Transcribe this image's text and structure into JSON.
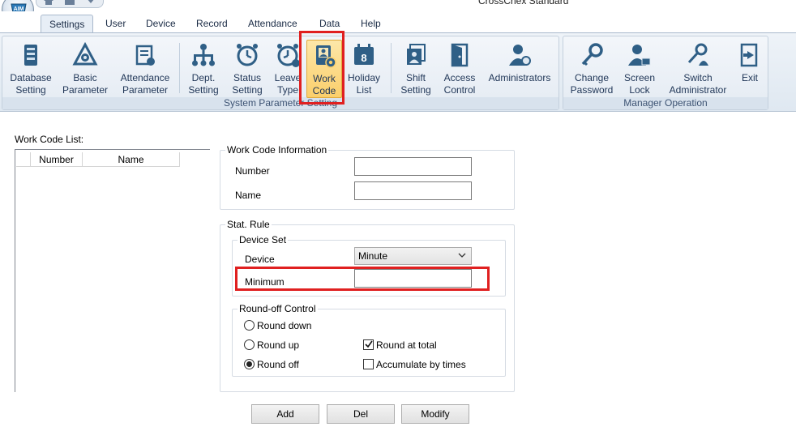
{
  "window": {
    "title": "CrossChex Standard"
  },
  "tabs": [
    {
      "label": "Settings",
      "active": true
    },
    {
      "label": "User"
    },
    {
      "label": "Device"
    },
    {
      "label": "Record"
    },
    {
      "label": "Attendance"
    },
    {
      "label": "Data"
    },
    {
      "label": "Help"
    }
  ],
  "ribbon": {
    "system_group_label": "System Parameter Setting",
    "manager_group_label": "Manager Operation",
    "buttons": [
      {
        "label": "Database\nSetting",
        "icon": "database-icon"
      },
      {
        "label": "Basic\nParameter",
        "icon": "basic-parameter-icon"
      },
      {
        "label": "Attendance\nParameter",
        "icon": "attendance-parameter-icon"
      },
      {
        "label": "Dept.\nSetting",
        "icon": "org-chart-icon"
      },
      {
        "label": "Status\nSetting",
        "icon": "alarm-clock-icon"
      },
      {
        "label": "Leave\nType",
        "icon": "leave-clock-icon"
      },
      {
        "label": "Work\nCode",
        "icon": "work-code-icon",
        "active": true
      },
      {
        "label": "Holiday\nList",
        "icon": "calendar-icon"
      },
      {
        "label": "Shift\nSetting",
        "icon": "shift-icon"
      },
      {
        "label": "Access\nControl",
        "icon": "door-icon"
      },
      {
        "label": "Administrators",
        "icon": "admin-user-icon"
      },
      {
        "label": "Change\nPassword",
        "icon": "key-icon"
      },
      {
        "label": "Screen\nLock",
        "icon": "user-lock-icon"
      },
      {
        "label": "Switch\nAdministrator",
        "icon": "switch-admin-icon"
      },
      {
        "label": "Exit",
        "icon": "exit-icon"
      }
    ]
  },
  "work_code_list": {
    "title": "Work Code List:",
    "columns": [
      "Number",
      "Name"
    ]
  },
  "work_code_info": {
    "title": "Work Code Information",
    "number_label": "Number",
    "number_value": "",
    "name_label": "Name",
    "name_value": ""
  },
  "stat_rule": {
    "title": "Stat. Rule",
    "device_set_title": "Device Set",
    "device_label": "Device",
    "device_value": "Minute",
    "minimum_label": "Minimum",
    "minimum_value": "",
    "roundoff_title": "Round-off Control",
    "round_down": "Round down",
    "round_up": "Round up",
    "round_off": "Round off",
    "round_at_total": "Round at total",
    "accumulate_by_times": "Accumulate by times",
    "selected_round": "Round off",
    "round_at_total_checked": true,
    "accumulate_checked": false
  },
  "actions": {
    "add": "Add",
    "del": "Del",
    "modify": "Modify"
  },
  "colors": {
    "highlight": "#e02020",
    "ribbon_icon": "#2f5f86"
  }
}
